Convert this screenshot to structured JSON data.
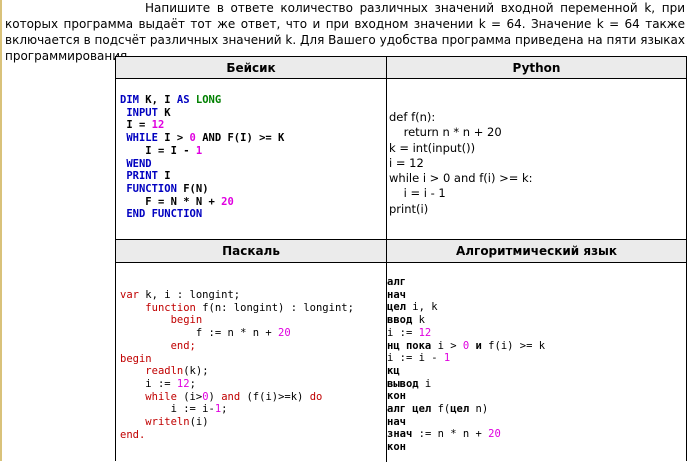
{
  "intro_text": "Напишите в ответе количество различных значений входной переменной k, при которых программа выдаёт тот же ответ, что и при входном значении k = 64. Значение k = 64 также включается в подсчёт различных значений k. Для Вашего удобства программа приведена на пяти языках программирования.",
  "headers": {
    "basic": "Бейсик",
    "python": "Python",
    "pascal": "Паскаль",
    "algo": "Алгоритмический язык"
  },
  "colors": {
    "keyword_blue": "#0000c0",
    "keyword_red": "#c00000",
    "keyword_green": "#008000",
    "number_magenta": "#e000e0",
    "header_bg": "#ebebeb"
  },
  "basic": {
    "dim_kw": "DIM",
    "dim_vars": " K, I ",
    "as_kw": "AS",
    "long_kw": "LONG",
    "input_kw": "INPUT",
    "input_var": " K",
    "i_assign": "I = ",
    "i_init": "12",
    "while_kw": "WHILE",
    "while_cond1": " I > ",
    "while_zero": "0",
    "while_cond2": " AND F(I) >= K",
    "dec_lhs": "I = I - ",
    "dec_one": "1",
    "wend_kw": "WEND",
    "print_kw": "PRINT",
    "print_var": " I",
    "function_kw": "FUNCTION",
    "function_sig": " F(N)",
    "f_expr": "F = N * N + ",
    "f_num": "20",
    "end_function_kw": "END FUNCTION"
  },
  "python": {
    "lines": [
      "def f(n):",
      "    return n * n + 20",
      "k = int(input())",
      "i = 12",
      "while i > 0 and f(i) >= k:",
      "    i = i - 1",
      "print(i)"
    ]
  },
  "pascal": {
    "var_kw": "var",
    "var_decl": " k, i : longint;",
    "function_kw": "function",
    "function_sig": " f(n: longint) : longint;",
    "begin1_kw": "begin",
    "f_assign": "f := n * n + ",
    "f_num": "20",
    "end1_kw": "end;",
    "begin2_kw": "begin",
    "readln_kw": "readln",
    "readln_args": "(k);",
    "i_assign": "i := ",
    "i_num": "12",
    "semicolon": ";",
    "while_kw": "while",
    "while_cond1": " (i>",
    "while_zero": "0",
    "while_cond2": ") ",
    "and_kw": "and",
    "while_cond3": " (f(i)>=k) ",
    "do_kw": "do",
    "dec_lhs": "i := i-",
    "dec_one": "1",
    "writeln_kw": "writeln",
    "writeln_args": "(i)",
    "end2_kw": "end."
  },
  "algo": {
    "alg": "алг",
    "nach1": "нач",
    "cel_kw": "цел",
    "cel_vars": " i, k",
    "vvod_kw": "ввод",
    "vvod_var": " k",
    "i_assign": "i := ",
    "i_num": "12",
    "nc_kw": "нц пока",
    "nc_cond1": " i > ",
    "nc_zero": "0",
    "nc_and": " и ",
    "nc_cond2": "f(i) >= k",
    "dec_lhs": "i := i - ",
    "dec_one": "1",
    "kc": "кц",
    "vyvod_kw": "вывод",
    "vyvod_var": " i",
    "kon1": "кон",
    "alg_cel_kw": "алг цел",
    "alg_cel_sig": " f(",
    "alg_cel_arg_kw": "цел",
    "alg_cel_arg": " n)",
    "nach2": "нач",
    "znach_kw": "знач",
    "znach_expr": " := n * n + ",
    "znach_num": "20",
    "kon2": "кон"
  }
}
